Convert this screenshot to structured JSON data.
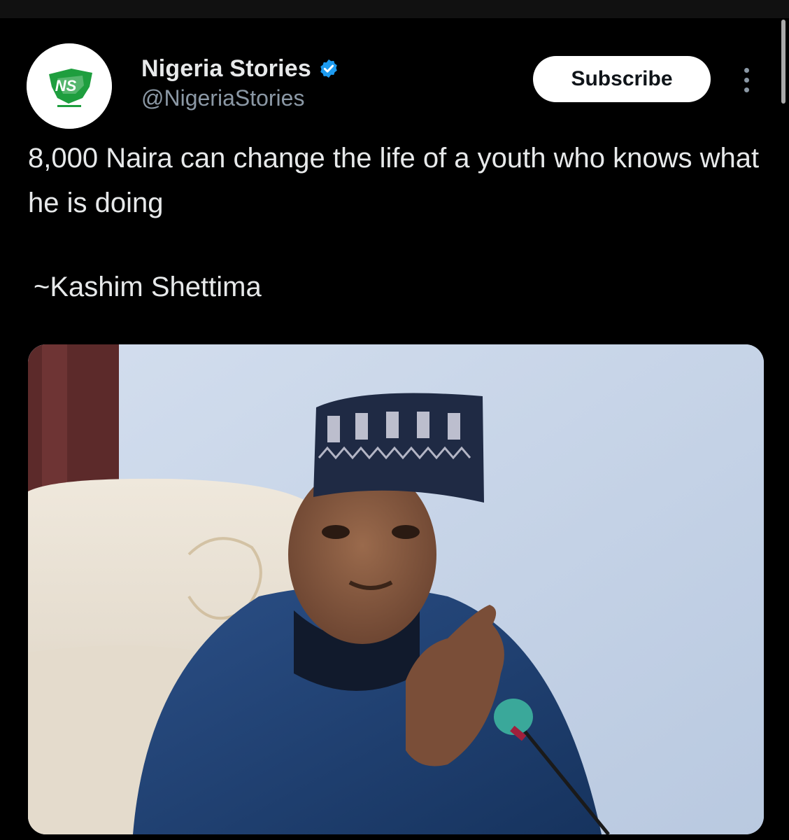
{
  "post": {
    "author": {
      "display_name": "Nigeria Stories",
      "handle": "@NigeriaStories",
      "verified": true,
      "avatar_icon": "ns-logo-icon",
      "avatar_logo_text": "NS"
    },
    "subscribe_label": "Subscribe",
    "more_icon": "more-vertical-icon",
    "text_lines": [
      "8,000 Naira can change the life of a youth who knows what he is doing"
    ],
    "attribution": "~Kashim Shettima"
  },
  "colors": {
    "background": "#000000",
    "text_primary": "#e7e9ea",
    "text_secondary": "#8b98a5",
    "verified_badge": "#1d9bf0",
    "subscribe_bg": "#ffffff",
    "logo_green": "#1e9e3e"
  }
}
